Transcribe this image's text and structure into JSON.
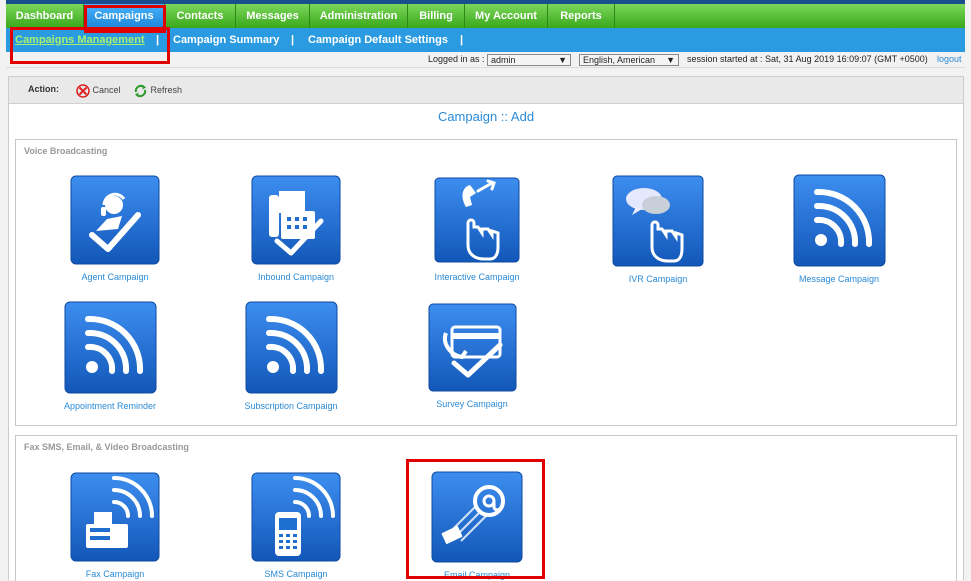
{
  "topnav": {
    "items": [
      {
        "label": "Dashboard"
      },
      {
        "label": "Campaigns"
      },
      {
        "label": "Contacts"
      },
      {
        "label": "Messages"
      },
      {
        "label": "Administration"
      },
      {
        "label": "Billing"
      },
      {
        "label": "My Account"
      },
      {
        "label": "Reports"
      }
    ]
  },
  "subnav": {
    "items": [
      {
        "label": "Campaigns Management"
      },
      {
        "label": "Campaign Summary"
      },
      {
        "label": "Campaign Default Settings"
      }
    ],
    "separator": "|"
  },
  "status": {
    "logged_in_label": "Logged in as :",
    "user": "admin",
    "language": "English, American",
    "session_text": "session started at : Sat, 31 Aug 2019 16:09:07 (GMT +0500)",
    "logout": "logout"
  },
  "actions": {
    "label": "Action:",
    "cancel": "Cancel",
    "refresh": "Refresh"
  },
  "page_title": "Campaign :: Add",
  "sections": {
    "voice": {
      "title": "Voice Broadcasting",
      "tiles": [
        {
          "label": "Agent Campaign",
          "icon": "agent-icon"
        },
        {
          "label": "Inbound Campaign",
          "icon": "fax-phone-icon"
        },
        {
          "label": "Interactive Campaign",
          "icon": "phone-touch-icon"
        },
        {
          "label": "IVR Campaign",
          "icon": "ivr-icon"
        },
        {
          "label": "Message Campaign",
          "icon": "broadcast-icon"
        },
        {
          "label": "Appointment Reminder",
          "icon": "broadcast-icon"
        },
        {
          "label": "Subscription Campaign",
          "icon": "broadcast-icon"
        },
        {
          "label": "Survey Campaign",
          "icon": "survey-icon"
        }
      ]
    },
    "fax": {
      "title": "Fax SMS, Email, & Video Broadcasting",
      "tiles": [
        {
          "label": "Fax Campaign",
          "icon": "fax-icon"
        },
        {
          "label": "SMS Campaign",
          "icon": "sms-icon"
        },
        {
          "label": "Email Campaign",
          "icon": "email-icon"
        }
      ]
    }
  },
  "colors": {
    "nav_green": "#3aa81a",
    "nav_blue": "#2a9be0",
    "tile_blue": "#1e6fd0",
    "link": "#2a8ad6",
    "highlight": "#e00000"
  }
}
